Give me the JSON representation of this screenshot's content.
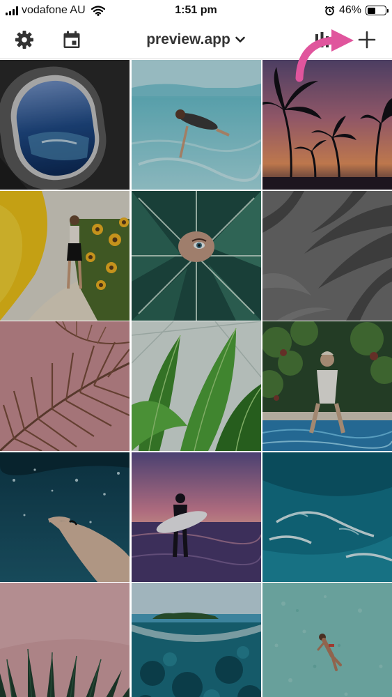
{
  "status_bar": {
    "carrier": "vodafone AU",
    "time": "1:51 pm",
    "battery_percent": "46%",
    "battery_level": 0.46
  },
  "toolbar": {
    "title": "preview.app",
    "icons": [
      "gear-icon",
      "calendar-icon",
      "chevron-down-icon",
      "bar-chart-icon",
      "plus-icon"
    ],
    "accent_arrow_color": "#e0559d"
  },
  "grid": {
    "columns": 3,
    "tiles": [
      {
        "subject": "airplane window"
      },
      {
        "subject": "woman swimming underwater"
      },
      {
        "subject": "palm trees at sunset"
      },
      {
        "subject": "woman in sunflower field"
      },
      {
        "subject": "face behind monstera leaf"
      },
      {
        "subject": "palm shadow on grey wall"
      },
      {
        "subject": "palm frond on pink wall"
      },
      {
        "subject": "banana leaves"
      },
      {
        "subject": "woman at pool edge"
      },
      {
        "subject": "hand under water"
      },
      {
        "subject": "surfer at sunset"
      },
      {
        "subject": "aerial ocean waves"
      },
      {
        "subject": "palm against pink wall"
      },
      {
        "subject": "island and coral split view"
      },
      {
        "subject": "swimmer in turquoise water"
      }
    ]
  }
}
